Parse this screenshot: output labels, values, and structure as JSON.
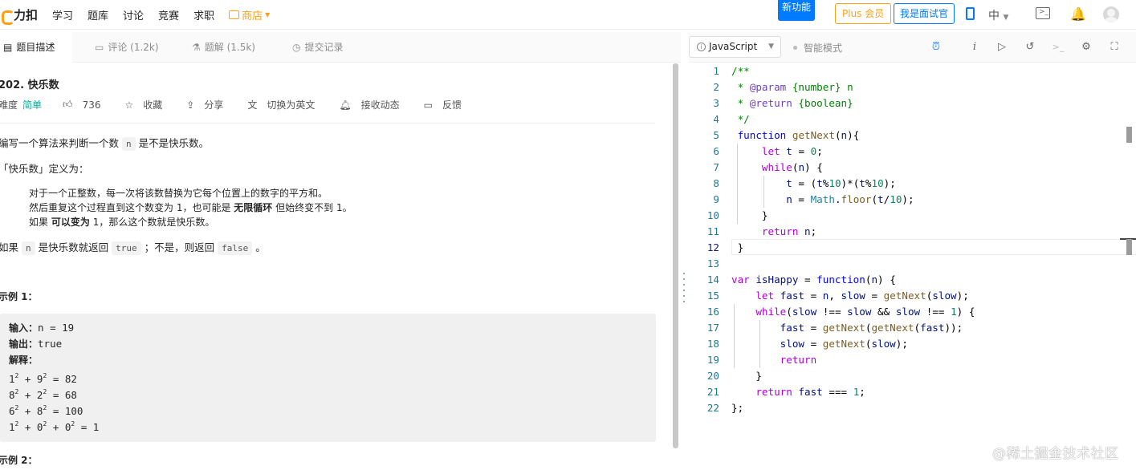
{
  "topnav": {
    "logo_text": "力扣",
    "items": [
      "学习",
      "题库",
      "讨论",
      "竞赛",
      "求职"
    ],
    "shop_label": "商店",
    "new_feature": "新功能",
    "plus_label": "Plus 会员",
    "interviewer_label": "我是面试官",
    "lang_label": "中"
  },
  "left_tabs": {
    "description": "题目描述",
    "comments": "评论 (1.2k)",
    "solutions": "题解 (1.5k)",
    "submissions": "提交记录"
  },
  "problem": {
    "title": "202. 快乐数",
    "difficulty_label": "难度",
    "difficulty": "简单",
    "likes": "736",
    "collect": "收藏",
    "share": "分享",
    "switch_lang": "切换为英文",
    "subscribe": "接收动态",
    "feedback": "反馈",
    "desc_1a": "编写一个算法来判断一个数",
    "desc_1_code": "n",
    "desc_1b": "是不是快乐数。",
    "desc_2": "「快乐数」定义为：",
    "quote_1": "对于一个正整数，每一次将该数替换为它每个位置上的数字的平方和。",
    "quote_2a": "然后重复这个过程直到这个数变为 1，也可能是",
    "quote_2b": "无限循环",
    "quote_2c": "但始终变不到 1。",
    "quote_3a": "如果",
    "quote_3b": "可以变为",
    "quote_3c": "1，那么这个数就是快乐数。",
    "desc_3a": "如果",
    "desc_3_code1": "n",
    "desc_3b": "是快乐数就返回",
    "desc_3_code2": "true",
    "desc_3c": "；不是，则返回",
    "desc_3_code3": "false",
    "desc_3d": "。",
    "example1_title": "示例 1：",
    "example1": {
      "input_label": "输入：",
      "input_val": "n = 19",
      "output_label": "输出：",
      "output_val": "true",
      "explain_label": "解释：",
      "rows": [
        [
          "1",
          "2",
          " + 9",
          "2",
          " = 82"
        ],
        [
          "8",
          "2",
          " + 2",
          "2",
          " = 68"
        ],
        [
          "6",
          "2",
          " + 8",
          "2",
          " = 100"
        ]
      ],
      "last_row": [
        "1",
        "2",
        " + 0",
        "2",
        " + 0",
        "2",
        " = 1"
      ]
    },
    "example2_title": "示例 2："
  },
  "editor_bar": {
    "language": "JavaScript",
    "smart_mode": "智能模式"
  },
  "code_lines": [
    "/**",
    " * @param {number} n",
    " * @return {boolean}",
    " */",
    " function getNext(n){",
    "     let t = 0;",
    "     while(n) {",
    "         t = (t%10)*(t%10);",
    "         n = Math.floor(t/10);",
    "     }",
    "     return n;",
    " }",
    "",
    "var isHappy = function(n) {",
    "    let fast = n, slow = getNext(slow);",
    "    while(slow !== slow && slow !== 1) {",
    "        fast = getNext(getNext(fast));",
    "        slow = getNext(slow);",
    "        return",
    "    }",
    "    return fast === 1;",
    "};"
  ],
  "current_line": 12,
  "watermark": "@稀土掘金技术社区"
}
